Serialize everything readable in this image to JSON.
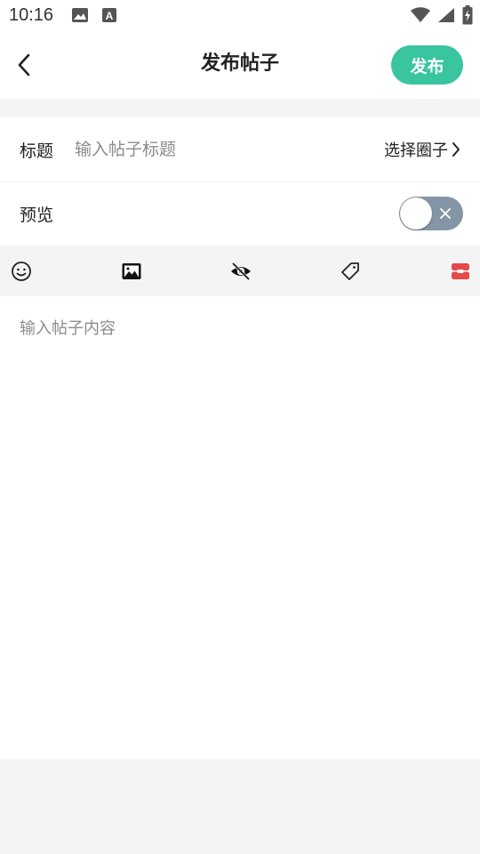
{
  "status_bar": {
    "time": "10:16",
    "icons": [
      "image-icon",
      "a-icon",
      "wifi-icon",
      "signal-icon",
      "battery-charging-icon"
    ]
  },
  "header": {
    "title": "发布帖子",
    "publish_label": "发布",
    "back_icon": "chevron-left-icon"
  },
  "form": {
    "title_label": "标题",
    "title_placeholder": "输入帖子标题",
    "title_value": "",
    "circle_select_label": "选择圈子",
    "preview_label": "预览",
    "preview_enabled": false
  },
  "toolbar": {
    "tools": [
      "emoji-icon",
      "image-icon",
      "hidden-eye-icon",
      "tag-icon",
      "red-box-icon"
    ]
  },
  "content": {
    "placeholder": "输入帖子内容",
    "value": ""
  },
  "colors": {
    "accent": "#38c5a0",
    "toggle_off": "#8496a6",
    "toolbar_red": "#e8474b"
  }
}
